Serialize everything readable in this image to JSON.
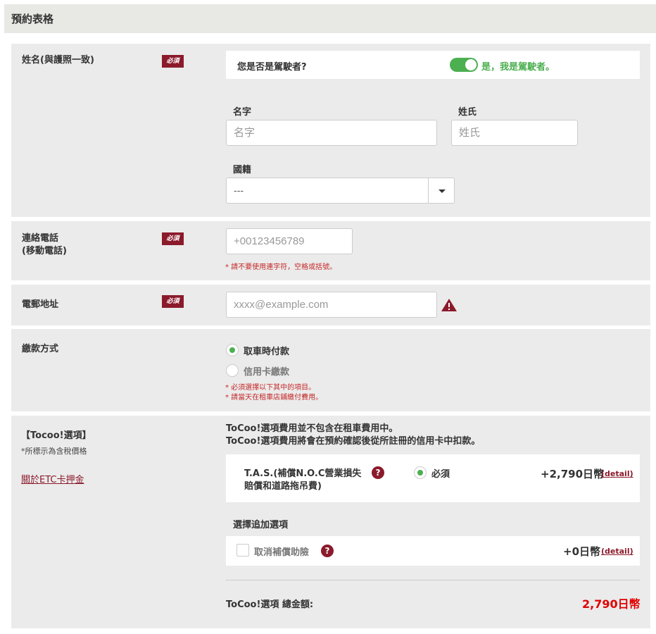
{
  "header": {
    "title": "預約表格"
  },
  "name_section": {
    "label": "姓名(與護照一致)",
    "required": "必須",
    "driver_question": "您是否是駕駛者?",
    "driver_answer": "是，我是駕駛者。",
    "first_name_label": "名字",
    "first_name_placeholder": "名字",
    "last_name_label": "姓氏",
    "last_name_placeholder": "姓氏",
    "nationality_label": "國籍",
    "nationality_value": "---"
  },
  "phone_section": {
    "label_line1": "連絡電話",
    "label_line2": "(移動電話)",
    "required": "必須",
    "placeholder": "+00123456789",
    "note": "* 請不要使用連字符，空格或括號。"
  },
  "email_section": {
    "label": "電郵地址",
    "required": "必須",
    "placeholder": "xxxx@example.com"
  },
  "payment_section": {
    "label": "繳款方式",
    "option_pickup": "取車時付款",
    "option_card": "信用卡繳款",
    "note1": "* 必須選擇以下其中的項目。",
    "note2": "* 請當天在租車店鋪繳付費用。"
  },
  "options_section": {
    "label": "【Tocoo!選項】",
    "sublabel": "*所標示為含稅價格",
    "etc_link": "關於ETC卡押金",
    "info_line1": "ToCoo!選項費用並不包含在租車費用中。",
    "info_line2": "ToCoo!選項費用將會在預約確認後從所註冊的信用卡中扣款。",
    "tas_line1": "T.A.S.(補償N.O.C營業損失",
    "tas_line2": "賠償和道路拖吊費)",
    "tas_required": "必須",
    "tas_price": "+2,790日幣",
    "detail": "(detail)",
    "addon_title": "選擇追加選項",
    "cancel_label": "取消補償助險",
    "cancel_price": "+0日幣",
    "total_label": "ToCoo!選項 總金額:",
    "total_value": "2,790日幣"
  },
  "colors": {
    "accent_red": "#8b1a2b",
    "toggle_green": "#4caf50",
    "total_red": "#e00000"
  }
}
